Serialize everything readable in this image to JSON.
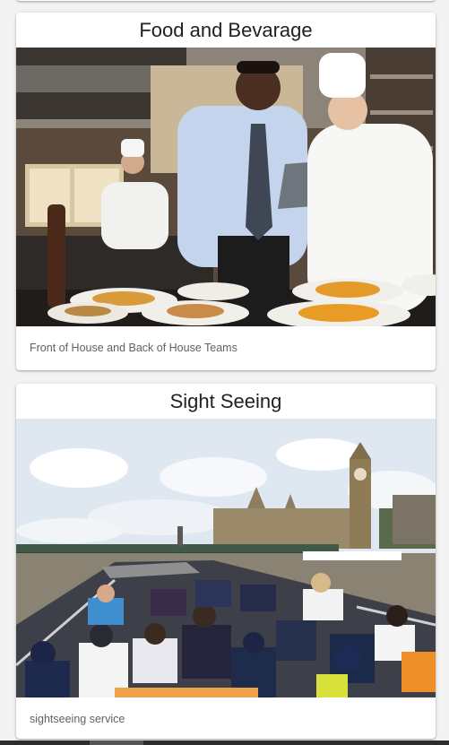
{
  "cards": [
    {
      "title": "Food and Bevarage",
      "image_alt": "photo-restaurant-kitchen",
      "caption": "Front of House and Back of House Teams"
    },
    {
      "title": "Sight Seeing",
      "image_alt": "photo-thames-boat-tour",
      "caption": "sightseeing service"
    }
  ],
  "colors": {
    "background": "#f2f2f2",
    "card": "#ffffff",
    "title_text": "#212121",
    "caption_text": "#616161"
  }
}
